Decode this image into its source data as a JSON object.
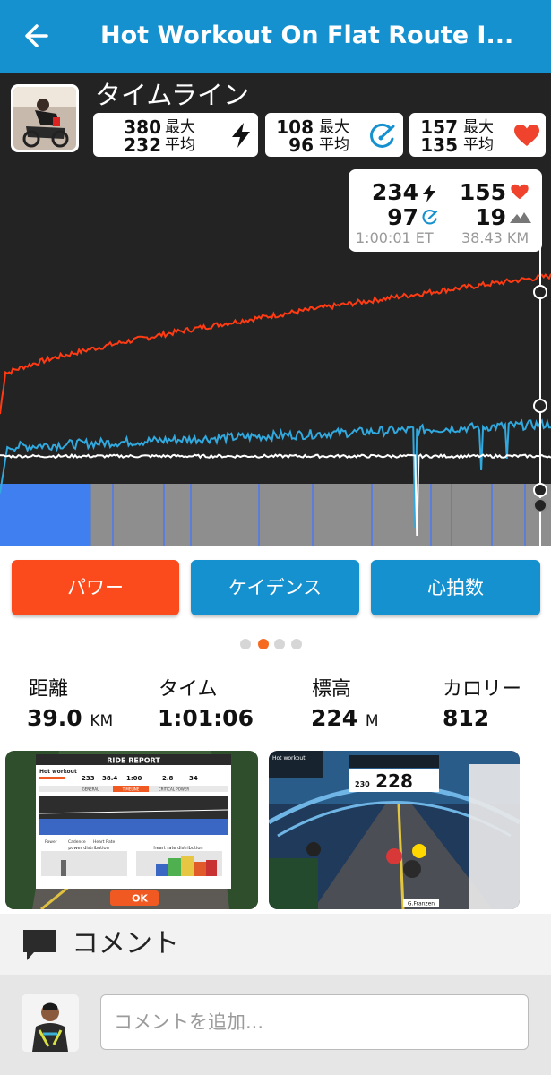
{
  "header": {
    "title": "Hot Workout On Flat Route I...",
    "accent": "#1591cf"
  },
  "timeline": {
    "title": "タイムライン",
    "power": {
      "max": "380",
      "avg": "232",
      "max_label": "最大",
      "avg_label": "平均",
      "icon": "lightning-icon"
    },
    "cadence": {
      "max": "108",
      "avg": "96",
      "max_label": "最大",
      "avg_label": "平均",
      "icon": "cadence-gauge-icon"
    },
    "heart_rate": {
      "max": "157",
      "avg": "135",
      "max_label": "最大",
      "avg_label": "平均",
      "icon": "heart-icon"
    }
  },
  "tooltip": {
    "power": "234",
    "heart_rate": "155",
    "cadence": "97",
    "elevation": "19",
    "time": "1:00:01 ET",
    "distance": "38.43 KM"
  },
  "chart_data": {
    "type": "line",
    "series": [
      {
        "name": "heart_rate",
        "color": "#ff3b14",
        "start": 100,
        "end": 157
      },
      {
        "name": "cadence",
        "color": "#31a9de",
        "start": 80,
        "end": 100
      },
      {
        "name": "power",
        "color": "#ffffff",
        "start": 232,
        "end": 234
      }
    ],
    "zones": [
      {
        "color": "#3f7ff0",
        "fraction": 0.165
      },
      {
        "color": "#8e8e8e",
        "fraction": 0.835
      }
    ]
  },
  "metric_buttons": [
    {
      "label": "パワー",
      "color": "#fb4b1c"
    },
    {
      "label": "ケイデンス",
      "color": "#1591cf"
    },
    {
      "label": "心拍数",
      "color": "#1591cf"
    }
  ],
  "pager": {
    "count": 4,
    "active": 1
  },
  "summary": {
    "distance": {
      "label": "距離",
      "value": "39.0",
      "unit": "KM"
    },
    "time": {
      "label": "タイム",
      "value": "1:01:06"
    },
    "elevation": {
      "label": "標高",
      "value": "224",
      "unit": "M"
    },
    "calories": {
      "label": "カロリー",
      "value": "812"
    }
  },
  "ride_report": {
    "header": "RIDE REPORT",
    "workout": "Hot workout",
    "stats": [
      "233",
      "38.4",
      "1:00",
      "2.8",
      "34"
    ],
    "tabs": [
      "GENERAL",
      "TIMELINE",
      "CRITICAL POWER"
    ],
    "legend": [
      "Power",
      "Cadence",
      "Heart Rate"
    ],
    "power_distribution": "power distribution",
    "hr_distribution": "heart rate distribution",
    "ok": "OK"
  },
  "game_screenshot": {
    "workout_label": "Hot workout",
    "speed": "228",
    "watts": "230",
    "rider": "G.Franzen"
  },
  "comments": {
    "title": "コメント",
    "placeholder": "コメントを追加..."
  }
}
